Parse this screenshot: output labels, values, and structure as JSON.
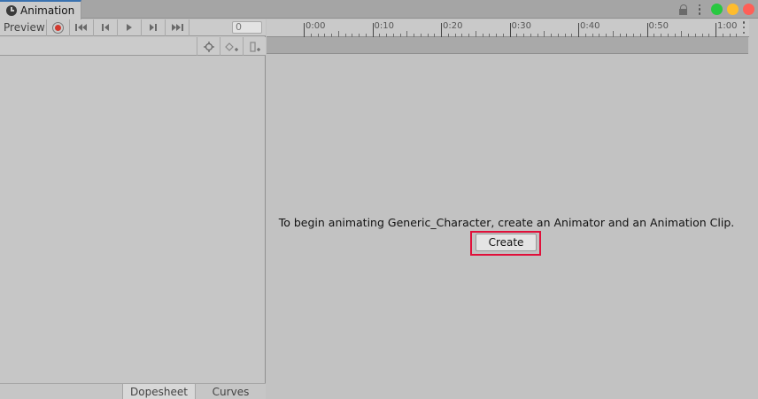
{
  "window": {
    "tab_title": "Animation",
    "tab_icon": "clock-icon",
    "controls": [
      "lock-icon",
      "menu-dots-icon",
      "green-dot",
      "yellow-dot",
      "red-dot"
    ],
    "colors": {
      "accent": "#3a72b0",
      "green": "#28c840",
      "yellow": "#febc2e",
      "red": "#ff5f57",
      "highlight": "#e0103a"
    }
  },
  "toolbar": {
    "preview_label": "Preview",
    "buttons": [
      "record-icon",
      "first-key-icon",
      "prev-key-icon",
      "play-icon",
      "next-key-icon",
      "last-key-icon"
    ],
    "frame_value": "0"
  },
  "subtoolbar": {
    "buttons": [
      "filter-by-selection-icon",
      "add-keyframe-icon",
      "add-event-icon"
    ]
  },
  "timeline": {
    "ticks": [
      "0:00",
      "0:10",
      "0:20",
      "0:30",
      "0:40",
      "0:50",
      "1:00"
    ]
  },
  "message": {
    "text": "To begin animating Generic_Character, create an Animator and an Animation Clip.",
    "create_label": "Create"
  },
  "bottom_tabs": {
    "dopesheet": "Dopesheet",
    "curves": "Curves"
  }
}
